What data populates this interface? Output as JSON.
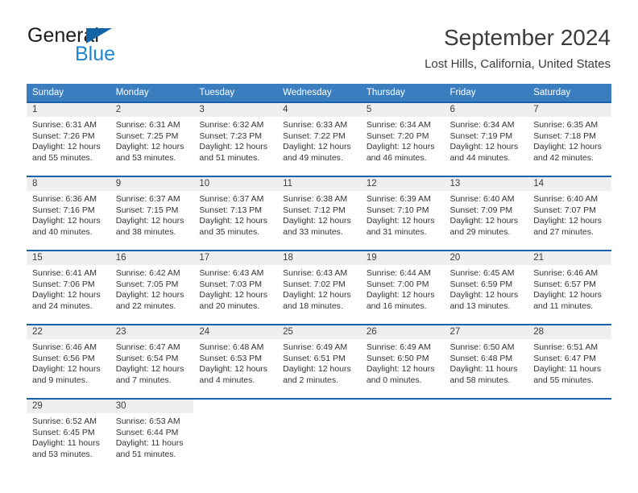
{
  "brand": {
    "line1": "General",
    "line2": "Blue",
    "triangle_color": "#1464a5",
    "blue_color": "#1f86d0"
  },
  "header": {
    "title": "September 2024",
    "subtitle": "Lost Hills, California, United States"
  },
  "theme": {
    "header_bg": "#3a7ebf",
    "row_border": "#1a61ab",
    "daynum_bg": "#efefef",
    "text": "#333333"
  },
  "weekday_headers": [
    "Sunday",
    "Monday",
    "Tuesday",
    "Wednesday",
    "Thursday",
    "Friday",
    "Saturday"
  ],
  "labels": {
    "sunrise_prefix": "Sunrise: ",
    "sunset_prefix": "Sunset: ",
    "daylight_prefix": "Daylight: "
  },
  "weeks": [
    [
      {
        "day": "1",
        "sunrise": "Sunrise: 6:31 AM",
        "sunset": "Sunset: 7:26 PM",
        "daylight": "Daylight: 12 hours and 55 minutes."
      },
      {
        "day": "2",
        "sunrise": "Sunrise: 6:31 AM",
        "sunset": "Sunset: 7:25 PM",
        "daylight": "Daylight: 12 hours and 53 minutes."
      },
      {
        "day": "3",
        "sunrise": "Sunrise: 6:32 AM",
        "sunset": "Sunset: 7:23 PM",
        "daylight": "Daylight: 12 hours and 51 minutes."
      },
      {
        "day": "4",
        "sunrise": "Sunrise: 6:33 AM",
        "sunset": "Sunset: 7:22 PM",
        "daylight": "Daylight: 12 hours and 49 minutes."
      },
      {
        "day": "5",
        "sunrise": "Sunrise: 6:34 AM",
        "sunset": "Sunset: 7:20 PM",
        "daylight": "Daylight: 12 hours and 46 minutes."
      },
      {
        "day": "6",
        "sunrise": "Sunrise: 6:34 AM",
        "sunset": "Sunset: 7:19 PM",
        "daylight": "Daylight: 12 hours and 44 minutes."
      },
      {
        "day": "7",
        "sunrise": "Sunrise: 6:35 AM",
        "sunset": "Sunset: 7:18 PM",
        "daylight": "Daylight: 12 hours and 42 minutes."
      }
    ],
    [
      {
        "day": "8",
        "sunrise": "Sunrise: 6:36 AM",
        "sunset": "Sunset: 7:16 PM",
        "daylight": "Daylight: 12 hours and 40 minutes."
      },
      {
        "day": "9",
        "sunrise": "Sunrise: 6:37 AM",
        "sunset": "Sunset: 7:15 PM",
        "daylight": "Daylight: 12 hours and 38 minutes."
      },
      {
        "day": "10",
        "sunrise": "Sunrise: 6:37 AM",
        "sunset": "Sunset: 7:13 PM",
        "daylight": "Daylight: 12 hours and 35 minutes."
      },
      {
        "day": "11",
        "sunrise": "Sunrise: 6:38 AM",
        "sunset": "Sunset: 7:12 PM",
        "daylight": "Daylight: 12 hours and 33 minutes."
      },
      {
        "day": "12",
        "sunrise": "Sunrise: 6:39 AM",
        "sunset": "Sunset: 7:10 PM",
        "daylight": "Daylight: 12 hours and 31 minutes."
      },
      {
        "day": "13",
        "sunrise": "Sunrise: 6:40 AM",
        "sunset": "Sunset: 7:09 PM",
        "daylight": "Daylight: 12 hours and 29 minutes."
      },
      {
        "day": "14",
        "sunrise": "Sunrise: 6:40 AM",
        "sunset": "Sunset: 7:07 PM",
        "daylight": "Daylight: 12 hours and 27 minutes."
      }
    ],
    [
      {
        "day": "15",
        "sunrise": "Sunrise: 6:41 AM",
        "sunset": "Sunset: 7:06 PM",
        "daylight": "Daylight: 12 hours and 24 minutes."
      },
      {
        "day": "16",
        "sunrise": "Sunrise: 6:42 AM",
        "sunset": "Sunset: 7:05 PM",
        "daylight": "Daylight: 12 hours and 22 minutes."
      },
      {
        "day": "17",
        "sunrise": "Sunrise: 6:43 AM",
        "sunset": "Sunset: 7:03 PM",
        "daylight": "Daylight: 12 hours and 20 minutes."
      },
      {
        "day": "18",
        "sunrise": "Sunrise: 6:43 AM",
        "sunset": "Sunset: 7:02 PM",
        "daylight": "Daylight: 12 hours and 18 minutes."
      },
      {
        "day": "19",
        "sunrise": "Sunrise: 6:44 AM",
        "sunset": "Sunset: 7:00 PM",
        "daylight": "Daylight: 12 hours and 16 minutes."
      },
      {
        "day": "20",
        "sunrise": "Sunrise: 6:45 AM",
        "sunset": "Sunset: 6:59 PM",
        "daylight": "Daylight: 12 hours and 13 minutes."
      },
      {
        "day": "21",
        "sunrise": "Sunrise: 6:46 AM",
        "sunset": "Sunset: 6:57 PM",
        "daylight": "Daylight: 12 hours and 11 minutes."
      }
    ],
    [
      {
        "day": "22",
        "sunrise": "Sunrise: 6:46 AM",
        "sunset": "Sunset: 6:56 PM",
        "daylight": "Daylight: 12 hours and 9 minutes."
      },
      {
        "day": "23",
        "sunrise": "Sunrise: 6:47 AM",
        "sunset": "Sunset: 6:54 PM",
        "daylight": "Daylight: 12 hours and 7 minutes."
      },
      {
        "day": "24",
        "sunrise": "Sunrise: 6:48 AM",
        "sunset": "Sunset: 6:53 PM",
        "daylight": "Daylight: 12 hours and 4 minutes."
      },
      {
        "day": "25",
        "sunrise": "Sunrise: 6:49 AM",
        "sunset": "Sunset: 6:51 PM",
        "daylight": "Daylight: 12 hours and 2 minutes."
      },
      {
        "day": "26",
        "sunrise": "Sunrise: 6:49 AM",
        "sunset": "Sunset: 6:50 PM",
        "daylight": "Daylight: 12 hours and 0 minutes."
      },
      {
        "day": "27",
        "sunrise": "Sunrise: 6:50 AM",
        "sunset": "Sunset: 6:48 PM",
        "daylight": "Daylight: 11 hours and 58 minutes."
      },
      {
        "day": "28",
        "sunrise": "Sunrise: 6:51 AM",
        "sunset": "Sunset: 6:47 PM",
        "daylight": "Daylight: 11 hours and 55 minutes."
      }
    ],
    [
      {
        "day": "29",
        "sunrise": "Sunrise: 6:52 AM",
        "sunset": "Sunset: 6:45 PM",
        "daylight": "Daylight: 11 hours and 53 minutes."
      },
      {
        "day": "30",
        "sunrise": "Sunrise: 6:53 AM",
        "sunset": "Sunset: 6:44 PM",
        "daylight": "Daylight: 11 hours and 51 minutes."
      },
      {
        "day": "",
        "sunrise": "",
        "sunset": "",
        "daylight": ""
      },
      {
        "day": "",
        "sunrise": "",
        "sunset": "",
        "daylight": ""
      },
      {
        "day": "",
        "sunrise": "",
        "sunset": "",
        "daylight": ""
      },
      {
        "day": "",
        "sunrise": "",
        "sunset": "",
        "daylight": ""
      },
      {
        "day": "",
        "sunrise": "",
        "sunset": "",
        "daylight": ""
      }
    ]
  ]
}
